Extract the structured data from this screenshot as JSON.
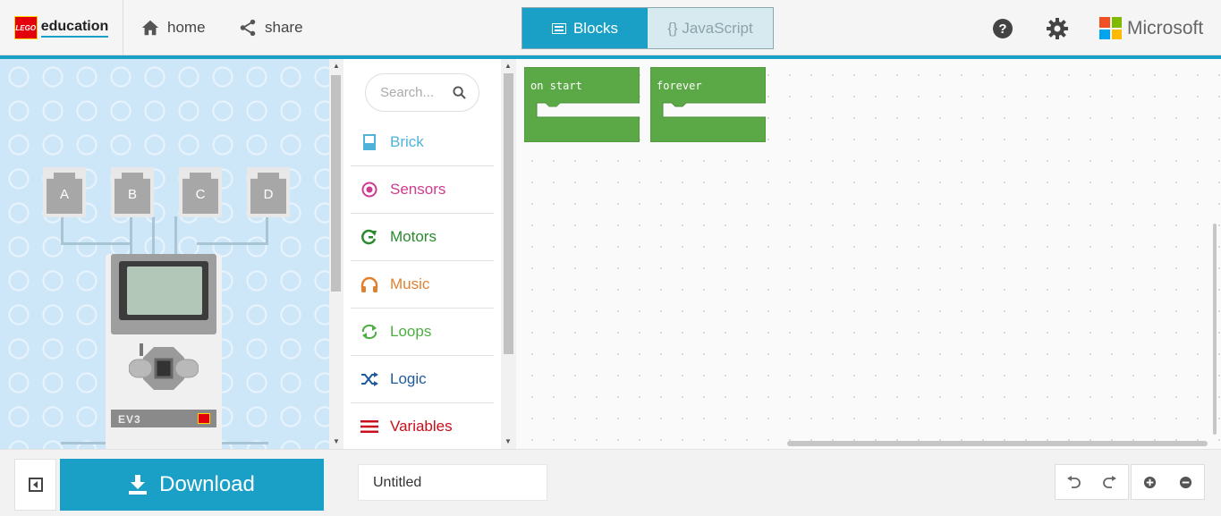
{
  "header": {
    "brand": {
      "lego": "LEGO",
      "education": "education"
    },
    "nav": [
      {
        "label": "home",
        "icon": "home-icon"
      },
      {
        "label": "share",
        "icon": "share-icon"
      }
    ],
    "modes": {
      "blocks": "Blocks",
      "javascript": "{} JavaScript",
      "active": "blocks"
    },
    "help_icon": "help-icon",
    "settings_icon": "gear-icon",
    "microsoft": "Microsoft"
  },
  "simulator": {
    "ports": [
      "A",
      "B",
      "C",
      "D"
    ],
    "brick_label": "EV3"
  },
  "toolbox": {
    "search_placeholder": "Search...",
    "categories": [
      {
        "label": "Brick",
        "color": "#4fb3d9",
        "icon": "brick-icon"
      },
      {
        "label": "Sensors",
        "color": "#cf3b8e",
        "icon": "sensor-icon"
      },
      {
        "label": "Motors",
        "color": "#2a8a2e",
        "icon": "motor-icon"
      },
      {
        "label": "Music",
        "color": "#e0812f",
        "icon": "headphones-icon"
      },
      {
        "label": "Loops",
        "color": "#4cae40",
        "icon": "loop-icon"
      },
      {
        "label": "Logic",
        "color": "#1f5a9c",
        "icon": "shuffle-icon"
      },
      {
        "label": "Variables",
        "color": "#c80f1b",
        "icon": "list-icon"
      }
    ]
  },
  "workspace": {
    "blocks": [
      {
        "label": "on start",
        "color": "#5ba946"
      },
      {
        "label": "forever",
        "color": "#5ba946"
      }
    ]
  },
  "bottom": {
    "download_label": "Download",
    "project_name": "Untitled"
  },
  "colors": {
    "accent": "#1aa0c6",
    "block": "#5ba946"
  }
}
